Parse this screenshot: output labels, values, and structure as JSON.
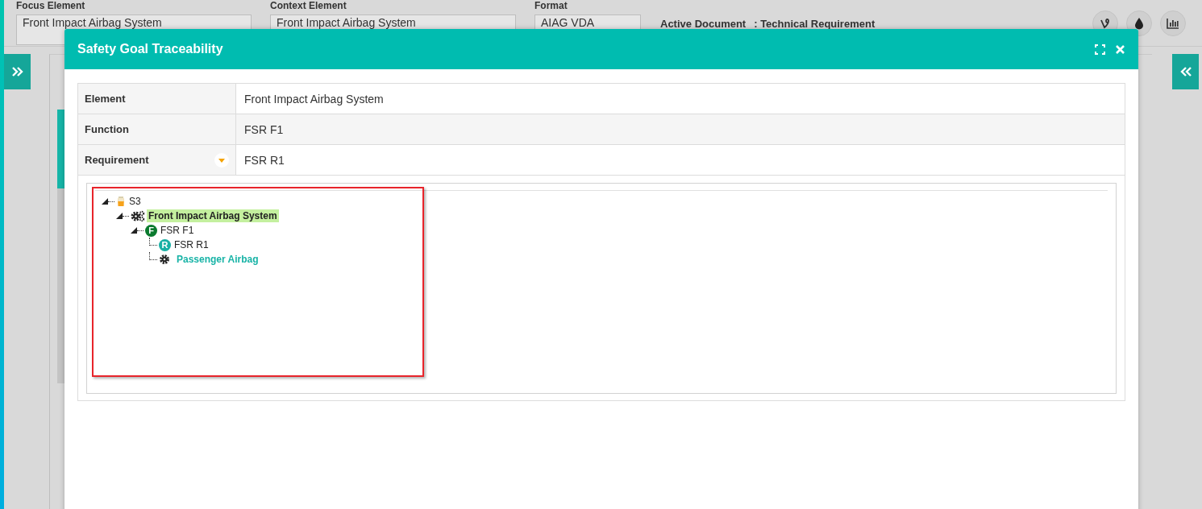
{
  "header": {
    "fields": [
      {
        "label": "Focus Element",
        "value": "Front Impact Airbag System"
      },
      {
        "label": "Context Element",
        "value": "Front Impact Airbag System"
      },
      {
        "label": "Format",
        "value": "AIAG VDA"
      }
    ],
    "active_document": {
      "label": "Active Document",
      "value": ": Technical Requirement"
    }
  },
  "dialog": {
    "title": "Safety Goal Traceability",
    "properties": [
      {
        "label": "Element",
        "value": "Front Impact Airbag System",
        "has_dropdown": false
      },
      {
        "label": "Function",
        "value": "FSR F1",
        "has_dropdown": false
      },
      {
        "label": "Requirement",
        "value": "FSR R1",
        "has_dropdown": true
      }
    ],
    "tree": [
      {
        "label": "S3",
        "kind": "goal",
        "expanded": true,
        "selected": false,
        "children": [
          {
            "label": "Front Impact Airbag System",
            "kind": "system",
            "expanded": true,
            "selected": true,
            "children": [
              {
                "label": "FSR F1",
                "kind": "function",
                "badge": "F",
                "expanded": true,
                "selected": false,
                "children": [
                  {
                    "label": "FSR R1",
                    "kind": "requirement",
                    "badge": "R",
                    "selected": false
                  },
                  {
                    "label": "Passenger Airbag",
                    "kind": "component",
                    "selected": false
                  }
                ]
              }
            ]
          }
        ]
      }
    ]
  }
}
